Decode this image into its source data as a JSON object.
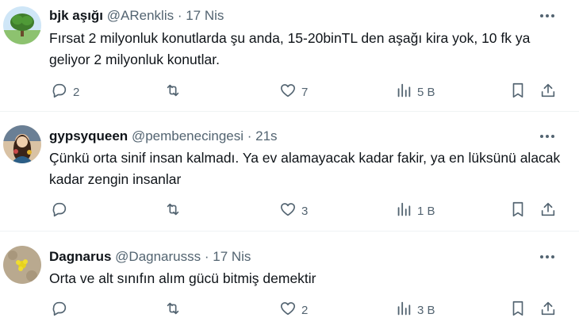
{
  "tweets": [
    {
      "name": "bjk aşığı",
      "handle": "@ARenklis",
      "sep": " · ",
      "time": "17 Nis",
      "text": "Fırsat 2 milyonluk konutlarda şu anda, 15-20binTL den aşağı kira yok, 10 fk ya geliyor 2 milyonluk konutlar.",
      "replies": "2",
      "retweets": "",
      "likes": "7",
      "views": "5 B"
    },
    {
      "name": "gypsyqueen",
      "handle": "@pembenecingesi",
      "sep": " · ",
      "time": "21s",
      "text": "Çünkü orta sinif insan kalmadı. Ya ev alamayacak kadar fakir, ya en lüksünü alacak kadar zengin insanlar",
      "replies": "",
      "retweets": "",
      "likes": "3",
      "views": "1 B"
    },
    {
      "name": "Dagnarus",
      "handle": "@Dagnarusss",
      "sep": " · ",
      "time": "17 Nis",
      "text": "Orta ve alt sınıfın alım gücü bitmiş demektir",
      "replies": "",
      "retweets": "",
      "likes": "2",
      "views": "3 B"
    }
  ],
  "icons": {
    "reply": "reply-icon",
    "retweet": "retweet-icon",
    "like": "heart-icon",
    "views": "views-icon",
    "bookmark": "bookmark-icon",
    "share": "share-icon",
    "more": "more-icon"
  },
  "colors": {
    "text": "#0f1419",
    "secondary": "#536471",
    "divider": "#eff3f4"
  }
}
